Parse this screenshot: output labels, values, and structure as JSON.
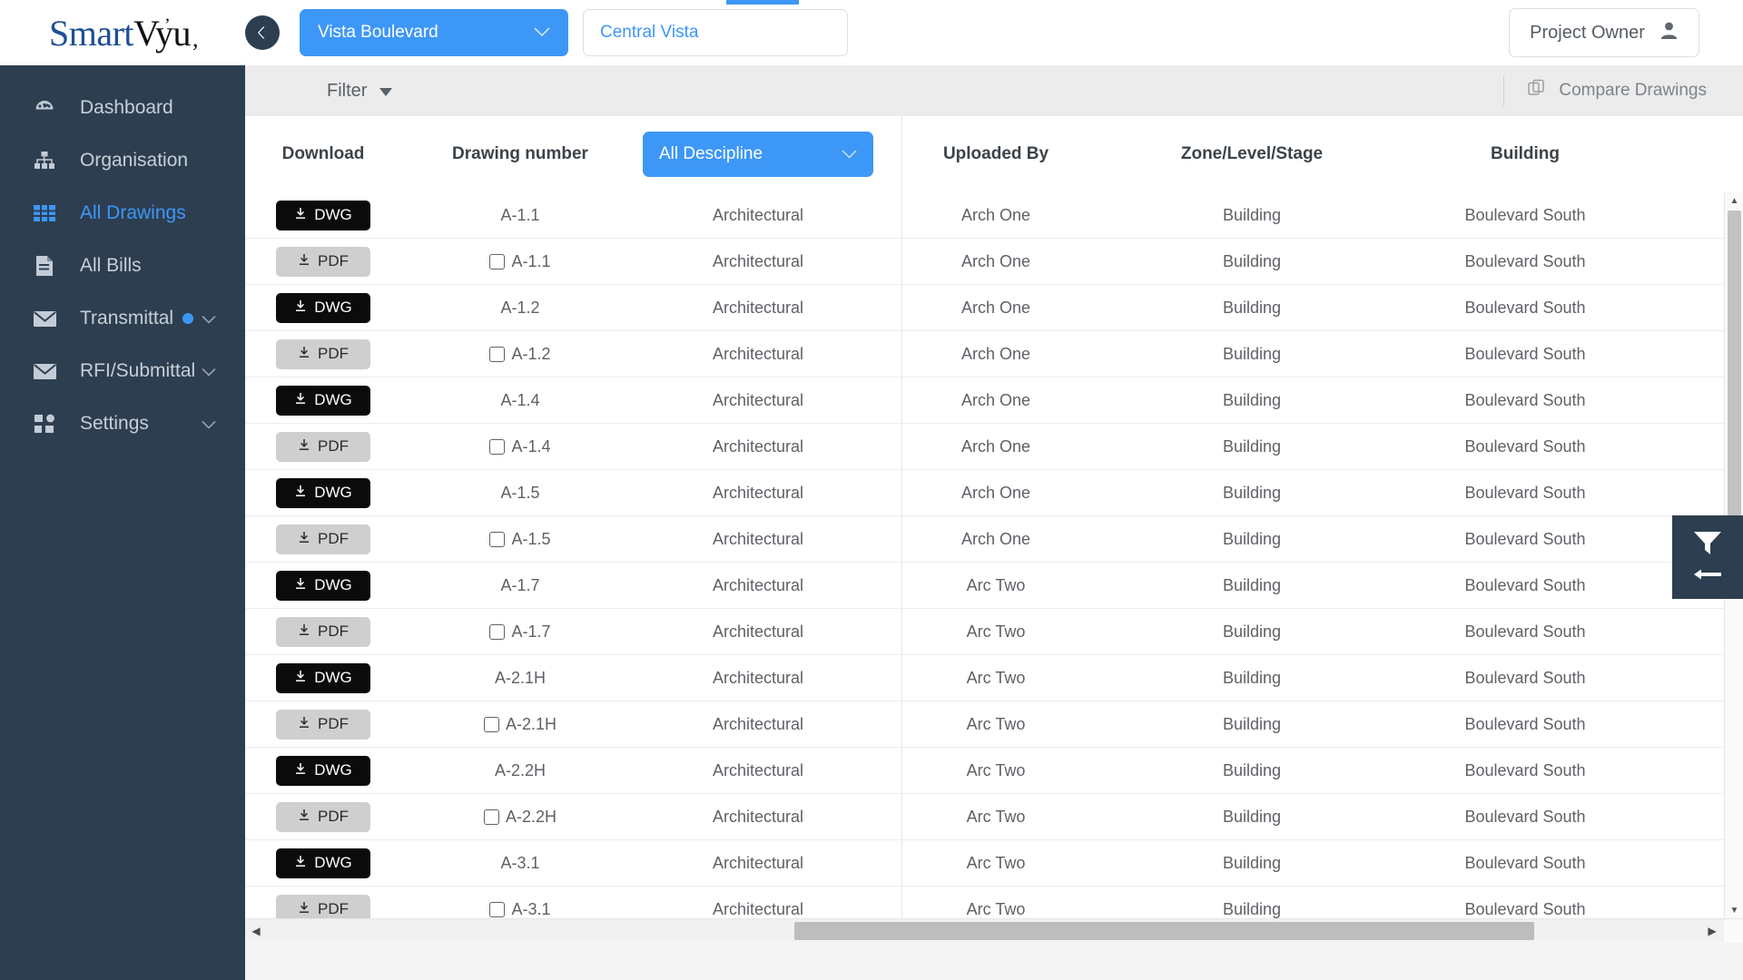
{
  "brand": {
    "smart": "Smart",
    "vyu": "Vyu"
  },
  "header": {
    "back_label": "back",
    "project": "Vista Boulevard",
    "subproject_value": "Central Vista",
    "subproject_placeholder": "Central Vista",
    "owner_label": "Project Owner"
  },
  "sidebar": {
    "items": [
      {
        "label": "Dashboard",
        "icon": "dashboard-icon",
        "active": false,
        "dot": false,
        "caret": false
      },
      {
        "label": "Organisation",
        "icon": "org-chart-icon",
        "active": false,
        "dot": false,
        "caret": false
      },
      {
        "label": "All Drawings",
        "icon": "grid-icon",
        "active": true,
        "dot": false,
        "caret": false
      },
      {
        "label": "All Bills",
        "icon": "document-icon",
        "active": false,
        "dot": false,
        "caret": false
      },
      {
        "label": "Transmittal",
        "icon": "envelope-icon",
        "active": false,
        "dot": true,
        "caret": true
      },
      {
        "label": "RFI/Submittal",
        "icon": "envelope-icon",
        "active": false,
        "dot": false,
        "caret": true
      },
      {
        "label": "Settings",
        "icon": "settings-tiles-icon",
        "active": false,
        "dot": false,
        "caret": true
      }
    ]
  },
  "toolbar": {
    "filter_label": "Filter",
    "compare_label": "Compare Drawings"
  },
  "table": {
    "columns": [
      {
        "key": "download",
        "label": "Download"
      },
      {
        "key": "drawing_no",
        "label": "Drawing number"
      },
      {
        "key": "discipline",
        "label": "All Descipline"
      },
      {
        "key": "uploaded_by",
        "label": "Uploaded By"
      },
      {
        "key": "zone",
        "label": "Zone/Level/Stage"
      },
      {
        "key": "building",
        "label": "Building"
      }
    ],
    "discipline_filter_label": "All Descipline",
    "rows": [
      {
        "file_type": "DWG",
        "checkbox": false,
        "drawing_no": "A-1.1",
        "discipline": "Architectural",
        "uploaded_by": "Arch One",
        "zone": "Building",
        "building": "Boulevard South"
      },
      {
        "file_type": "PDF",
        "checkbox": true,
        "drawing_no": "A-1.1",
        "discipline": "Architectural",
        "uploaded_by": "Arch One",
        "zone": "Building",
        "building": "Boulevard South"
      },
      {
        "file_type": "DWG",
        "checkbox": false,
        "drawing_no": "A-1.2",
        "discipline": "Architectural",
        "uploaded_by": "Arch One",
        "zone": "Building",
        "building": "Boulevard South"
      },
      {
        "file_type": "PDF",
        "checkbox": true,
        "drawing_no": "A-1.2",
        "discipline": "Architectural",
        "uploaded_by": "Arch One",
        "zone": "Building",
        "building": "Boulevard South"
      },
      {
        "file_type": "DWG",
        "checkbox": false,
        "drawing_no": "A-1.4",
        "discipline": "Architectural",
        "uploaded_by": "Arch One",
        "zone": "Building",
        "building": "Boulevard South"
      },
      {
        "file_type": "PDF",
        "checkbox": true,
        "drawing_no": "A-1.4",
        "discipline": "Architectural",
        "uploaded_by": "Arch One",
        "zone": "Building",
        "building": "Boulevard South"
      },
      {
        "file_type": "DWG",
        "checkbox": false,
        "drawing_no": "A-1.5",
        "discipline": "Architectural",
        "uploaded_by": "Arch One",
        "zone": "Building",
        "building": "Boulevard South"
      },
      {
        "file_type": "PDF",
        "checkbox": true,
        "drawing_no": "A-1.5",
        "discipline": "Architectural",
        "uploaded_by": "Arch One",
        "zone": "Building",
        "building": "Boulevard South"
      },
      {
        "file_type": "DWG",
        "checkbox": false,
        "drawing_no": "A-1.7",
        "discipline": "Architectural",
        "uploaded_by": "Arc Two",
        "zone": "Building",
        "building": "Boulevard South"
      },
      {
        "file_type": "PDF",
        "checkbox": true,
        "drawing_no": "A-1.7",
        "discipline": "Architectural",
        "uploaded_by": "Arc Two",
        "zone": "Building",
        "building": "Boulevard South"
      },
      {
        "file_type": "DWG",
        "checkbox": false,
        "drawing_no": "A-2.1H",
        "discipline": "Architectural",
        "uploaded_by": "Arc Two",
        "zone": "Building",
        "building": "Boulevard South"
      },
      {
        "file_type": "PDF",
        "checkbox": true,
        "drawing_no": "A-2.1H",
        "discipline": "Architectural",
        "uploaded_by": "Arc Two",
        "zone": "Building",
        "building": "Boulevard South"
      },
      {
        "file_type": "DWG",
        "checkbox": false,
        "drawing_no": "A-2.2H",
        "discipline": "Architectural",
        "uploaded_by": "Arc Two",
        "zone": "Building",
        "building": "Boulevard South"
      },
      {
        "file_type": "PDF",
        "checkbox": true,
        "drawing_no": "A-2.2H",
        "discipline": "Architectural",
        "uploaded_by": "Arc Two",
        "zone": "Building",
        "building": "Boulevard South"
      },
      {
        "file_type": "DWG",
        "checkbox": false,
        "drawing_no": "A-3.1",
        "discipline": "Architectural",
        "uploaded_by": "Arc Two",
        "zone": "Building",
        "building": "Boulevard South"
      },
      {
        "file_type": "PDF",
        "checkbox": true,
        "drawing_no": "A-3.1",
        "discipline": "Architectural",
        "uploaded_by": "Arc Two",
        "zone": "Building",
        "building": "Boulevard South"
      }
    ]
  },
  "filter_tab": {
    "label": "filter-panel-toggle"
  },
  "colors": {
    "accent": "#3d97f7",
    "sidebar": "#2d3e50",
    "toolbar": "#ececec",
    "dwg": "#0b0b0b",
    "pdf": "#cfcfcf"
  }
}
